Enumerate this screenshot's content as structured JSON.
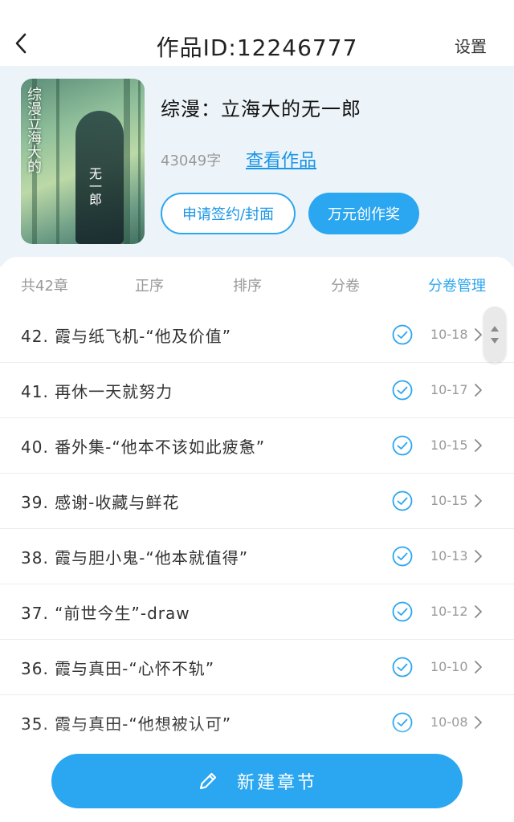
{
  "topbar": {
    "title": "作品ID:12246777",
    "settings_label": "设置"
  },
  "work": {
    "name": "综漫：立海大的无一郎",
    "word_count": "43049字",
    "view_link": "查看作品",
    "cover_title": "综漫立海大的",
    "cover_author": "无一郎",
    "apply_button": "申请签约/封面",
    "contest_button": "万元创作奖"
  },
  "filters": {
    "total": "共42章",
    "asc": "正序",
    "sort": "排序",
    "volume": "分卷",
    "volume_manage": "分卷管理"
  },
  "chapters": [
    {
      "title": "42. 霞与纸飞机-“他及价值”",
      "date": "10-18"
    },
    {
      "title": "41. 再休一天就努力",
      "date": "10-17"
    },
    {
      "title": "40. 番外集-“他本不该如此疲惫”",
      "date": "10-15"
    },
    {
      "title": "39. 感谢-收藏与鲜花",
      "date": "10-15"
    },
    {
      "title": "38. 霞与胆小鬼-“他本就值得”",
      "date": "10-13"
    },
    {
      "title": "37. “前世今生”-draw",
      "date": "10-12"
    },
    {
      "title": "36. 霞与真田-“心怀不轨”",
      "date": "10-10"
    },
    {
      "title": "35. 霞与真田-“他想被认可”",
      "date": "10-08"
    }
  ],
  "bottom": {
    "new_chapter_label": "新建章节"
  },
  "colors": {
    "accent": "#2ba6f0",
    "header_bg": "#edf4f9"
  }
}
